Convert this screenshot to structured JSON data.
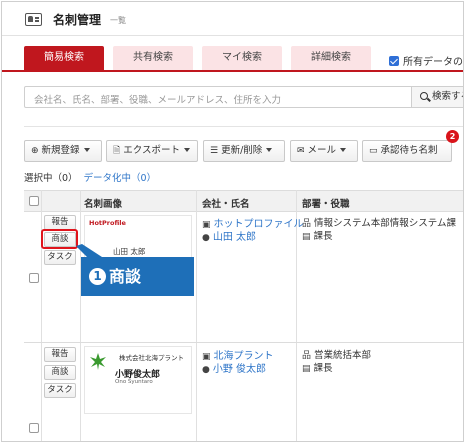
{
  "header": {
    "title": "名刺管理",
    "subtitle": "一覧"
  },
  "tabs": [
    {
      "label": "簡易検索",
      "active": true
    },
    {
      "label": "共有検索"
    },
    {
      "label": "マイ検索"
    },
    {
      "label": "詳細検索"
    }
  ],
  "own_data_label": "所有データのみ",
  "search": {
    "placeholder": "会社名、氏名、部署、役職、メールアドレス、住所を入力",
    "button": "検索する"
  },
  "toolbar": {
    "new": "新規登録",
    "export": "エクスポート",
    "update": "更新/削除",
    "mail": "メール",
    "approval": "承認待ち名刺",
    "approval_badge": "2"
  },
  "selection": {
    "selected": "選択中（0）",
    "digitizing": "データ化中（0）"
  },
  "table": {
    "headers": {
      "image": "名刺画像",
      "company": "会社・氏名",
      "dept": "部署・役職"
    },
    "rows": [
      {
        "actions": [
          "報告",
          "商談",
          "タスク"
        ],
        "card": {
          "logo": "HotProfile",
          "name": "山田 太郎"
        },
        "company": "ホットプロファイル",
        "person": "山田 太郎",
        "dept": "情報システム本部情報システム課",
        "title": "課長"
      },
      {
        "actions": [
          "報告",
          "商談",
          "タスク"
        ],
        "card": {
          "company": "株式会社北海プラント",
          "name": "小野俊太郎",
          "roman": "Ono Syuntaro"
        },
        "company": "北海プラント",
        "person": "小野 俊太郎",
        "dept": "営業統括本部",
        "title": "課長"
      }
    ]
  },
  "annotation": {
    "number": "1",
    "label": "商談"
  },
  "colors": {
    "accent": "#c0171e",
    "link": "#2e75c8",
    "callout": "#1e6fb8"
  }
}
